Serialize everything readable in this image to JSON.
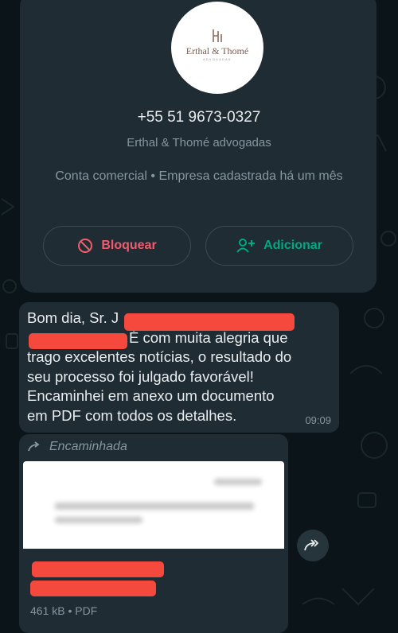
{
  "contact": {
    "logo_name": "Erthal & Thomé",
    "logo_subtitle": "ADVOGADAS",
    "phone": "+55 51 9673-0327",
    "business_name": "Erthal & Thomé advogadas",
    "account_info": "Conta comercial • Empresa cadastrada há um mês",
    "block_label": "Bloquear",
    "add_label": "Adicionar"
  },
  "message": {
    "line1": "Bom dia, Sr. J",
    "line2": "É com muita alegria que",
    "body": "trago excelentes notícias, o resultado do\nseu processo foi julgado favorável!\nEncaminhei em anexo um documento\nem PDF com todos os detalhes.",
    "time": "09:09"
  },
  "forwarded": {
    "label": "Encaminhada",
    "file_meta": "461 kB • PDF"
  },
  "colors": {
    "background": "#0b1418",
    "bubble": "#1f2c33",
    "block_red": "#f15c6d",
    "add_green": "#00a884",
    "redaction": "#f4493c"
  },
  "icons": [
    "block-icon",
    "add-contact-icon",
    "forward-arrow-icon",
    "share-forward-icon"
  ]
}
